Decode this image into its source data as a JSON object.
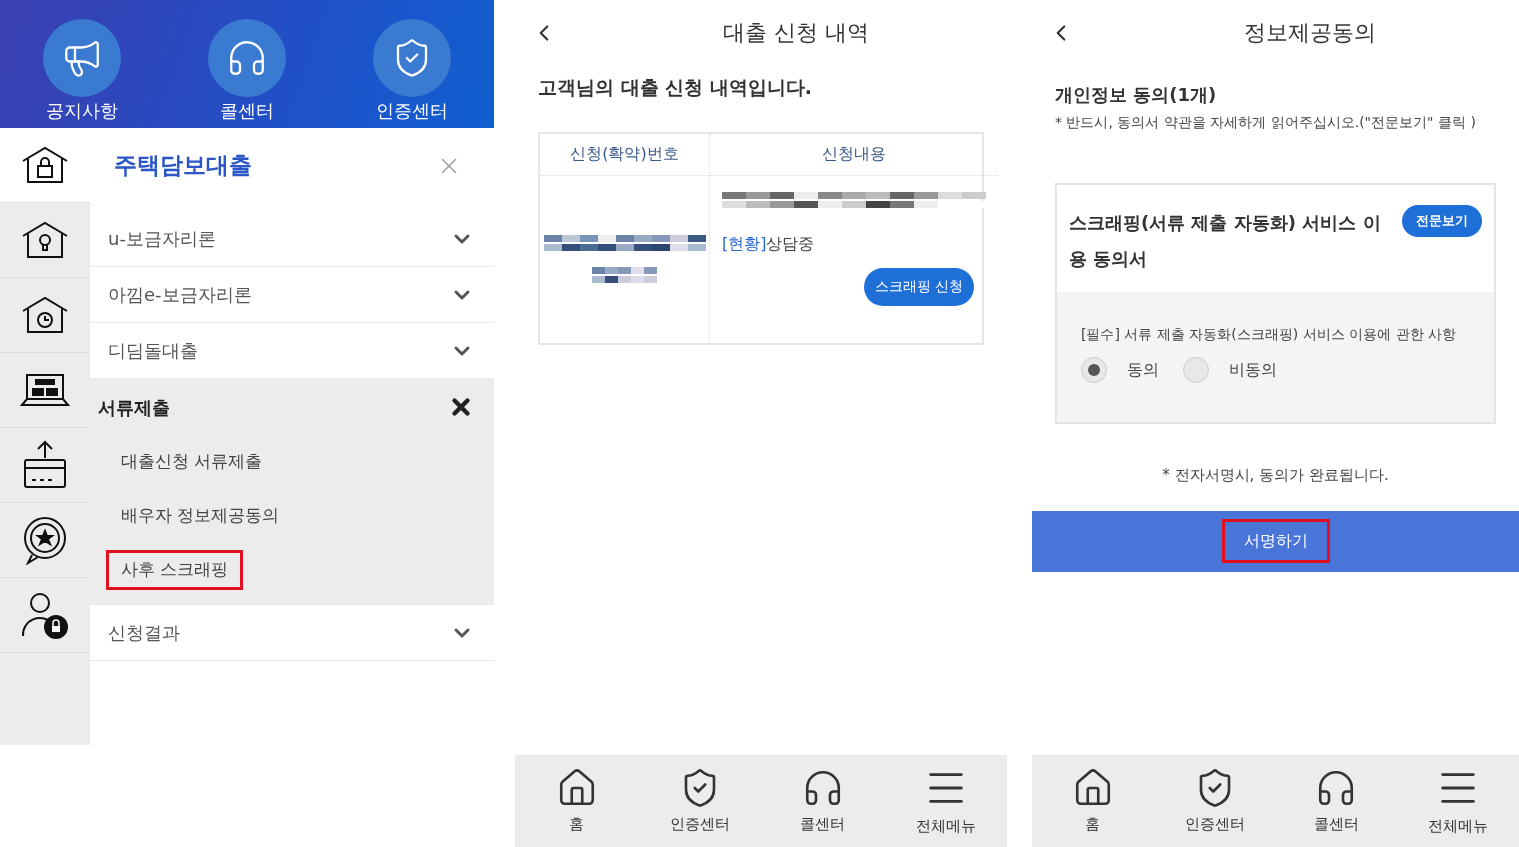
{
  "left_panel": {
    "shortcuts": [
      {
        "label": "공지사항"
      },
      {
        "label": "콜센터"
      },
      {
        "label": "인증센터"
      }
    ],
    "sidebar": [
      {
        "selected": true
      },
      {
        "selected": false
      },
      {
        "selected": false
      },
      {
        "selected": false
      },
      {
        "selected": false
      },
      {
        "selected": false
      },
      {
        "selected": false
      }
    ],
    "menu_title": "주택담보대출",
    "menu_items": [
      {
        "label": "u-보금자리론",
        "expanded": false
      },
      {
        "label": "아낌e-보금자리론",
        "expanded": false
      },
      {
        "label": "디딤돌대출",
        "expanded": false
      },
      {
        "label": "서류제출",
        "expanded": true,
        "children": [
          {
            "label": "대출신청 서류제출",
            "highlighted": false
          },
          {
            "label": "배우자 정보제공동의",
            "highlighted": false
          },
          {
            "label": "사후 스크래핑",
            "highlighted": true
          }
        ]
      },
      {
        "label": "신청결과",
        "expanded": false
      }
    ]
  },
  "middle_panel": {
    "title": "대출 신청 내역",
    "subtitle": "고객님의 대출 신청 내역입니다.",
    "table": {
      "columns": [
        "신청(확약)번호",
        "신청내용"
      ],
      "status_tag": "[현황]",
      "status": "상담중",
      "button": "스크래핑 신청"
    },
    "bottom_nav": [
      {
        "label": "홈"
      },
      {
        "label": "인증센터"
      },
      {
        "label": "콜센터"
      },
      {
        "label": "전체메뉴"
      }
    ]
  },
  "right_panel": {
    "title": "정보제공동의",
    "section_title": "개인정보 동의(1개)",
    "notice": "* 반드시, 동의서 약관을 자세하게 읽어주십시오.(\"전문보기\" 클릭 )",
    "card": {
      "title": "스크래핑(서류 제출 자동화) 서비스 이용 동의서",
      "view_button": "전문보기",
      "item_label": "[필수] 서류 제출 자동화(스크래핑) 서비스 이용에 관한 사항",
      "options": [
        {
          "label": "동의",
          "selected": true
        },
        {
          "label": "비동의",
          "selected": false
        }
      ]
    },
    "footer_note": "* 전자서명시, 동의가 완료됩니다.",
    "sign_button": {
      "label": "서명하기",
      "highlighted": true
    },
    "bottom_nav": [
      {
        "label": "홈"
      },
      {
        "label": "인증센터"
      },
      {
        "label": "콜센터"
      },
      {
        "label": "전체메뉴"
      }
    ]
  }
}
